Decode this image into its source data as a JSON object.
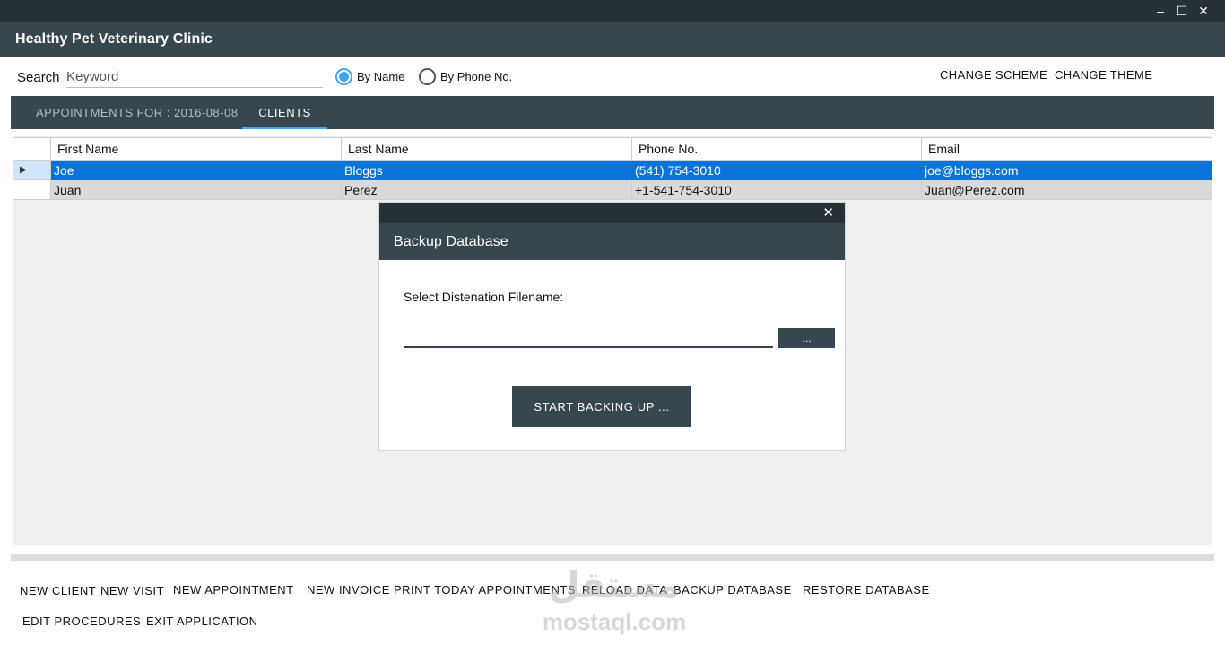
{
  "window": {
    "minimize_glyph": "–",
    "maximize_glyph": "☐",
    "close_glyph": "✕"
  },
  "app": {
    "title": "Healthy Pet Veterinary Clinic"
  },
  "search": {
    "label": "Search",
    "placeholder": "Keyword",
    "options": [
      {
        "label": "By Name",
        "selected": true
      },
      {
        "label": "By Phone No.",
        "selected": false
      }
    ]
  },
  "top_actions": {
    "change_scheme": "CHANGE SCHEME",
    "change_theme": "CHANGE THEME"
  },
  "tabs": [
    {
      "label": "APPOINTMENTS FOR : 2016-08-08",
      "active": false
    },
    {
      "label": "CLIENTS",
      "active": true
    }
  ],
  "clients_table": {
    "columns": [
      "First Name",
      "Last Name",
      "Phone No.",
      "Email"
    ],
    "rows": [
      {
        "first": "Joe",
        "last": "Bloggs",
        "phone": "(541) 754-3010",
        "email": "joe@bloggs.com",
        "selected": true
      },
      {
        "first": "Juan",
        "last": "Perez",
        "phone": "+1-541-754-3010",
        "email": "Juan@Perez.com",
        "selected": false
      }
    ],
    "row_pointer": "▶"
  },
  "dialog": {
    "title": "Backup Database",
    "close_glyph": "✕",
    "prompt": "Select Distenation Filename:",
    "filename_value": "",
    "browse_label": "...",
    "start_label": "START BACKING UP ..."
  },
  "actions": {
    "new_client": "NEW CLIENT",
    "new_visit": "NEW VISIT",
    "new_appointment": "NEW APPOINTMENT",
    "new_invoice": "NEW INVOICE",
    "print_today": "PRINT TODAY APPOINTMENTS",
    "reload_data": "RELOAD DATA",
    "backup_database": "BACKUP DATABASE",
    "restore_database": "RESTORE DATABASE",
    "edit_procedures": "EDIT PROCEDURES",
    "exit_application": "EXIT APPLICATION"
  },
  "watermark": {
    "logo_text": "مستقل",
    "site": "mostaql.com"
  },
  "colors": {
    "titlebar": "#263238",
    "header": "#37474f",
    "accent": "#42a5f5",
    "selected_row": "#0a74da",
    "content_bg": "#efefef"
  }
}
